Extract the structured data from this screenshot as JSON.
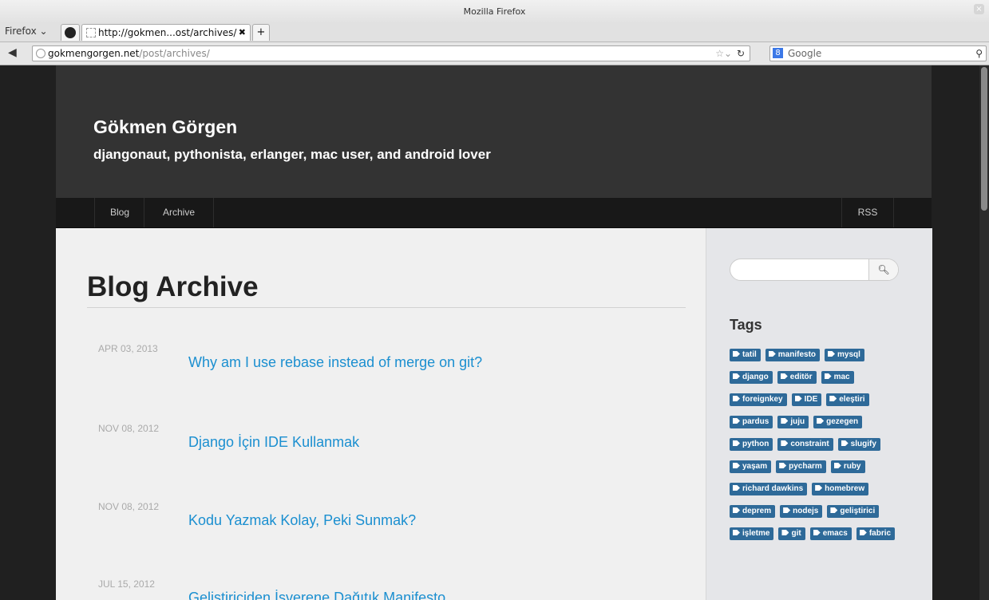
{
  "window": {
    "title": "Mozilla Firefox"
  },
  "browser": {
    "menu_label": "Firefox",
    "tabs": [
      {
        "label": "http://gokmen...ost/archives/"
      }
    ],
    "new_tab_label": "+",
    "url_domain": "gokmengorgen.net",
    "url_path": "/post/archives/",
    "search_engine": "Google"
  },
  "site": {
    "title": "Gökmen Görgen",
    "subtitle": "djangonaut, pythonista, erlanger, mac user, and android lover",
    "nav": {
      "blog": "Blog",
      "archive": "Archive",
      "rss": "RSS"
    }
  },
  "archive": {
    "heading": "Blog Archive",
    "posts": [
      {
        "date": "APR 03, 2013",
        "title": "Why am I use rebase instead of merge on git?"
      },
      {
        "date": "NOV 08, 2012",
        "title": "Django İçin IDE Kullanmak"
      },
      {
        "date": "NOV 08, 2012",
        "title": "Kodu Yazmak Kolay, Peki Sunmak?"
      },
      {
        "date": "JUL 15, 2012",
        "title": "Geliştiriciden İşverene Dağıtık Manifesto"
      }
    ]
  },
  "sidebar": {
    "search_placeholder": "",
    "tags_heading": "Tags",
    "tags": [
      "tatil",
      "manifesto",
      "mysql",
      "django",
      "editör",
      "mac",
      "foreignkey",
      "IDE",
      "eleştiri",
      "pardus",
      "juju",
      "gezegen",
      "python",
      "constraint",
      "slugify",
      "yaşam",
      "pycharm",
      "ruby",
      "richard dawkins",
      "homebrew",
      "deprem",
      "nodejs",
      "geliştirici",
      "işletme",
      "git",
      "emacs",
      "fabric"
    ]
  },
  "icons": {
    "tag": "tag-icon",
    "search": "search-icon",
    "back": "back-arrow-icon",
    "reload": "reload-icon",
    "bookmark": "star-icon"
  },
  "colors": {
    "link": "#1b8fd0",
    "tag_bg": "#2e6a99",
    "header_bg": "#333333"
  }
}
